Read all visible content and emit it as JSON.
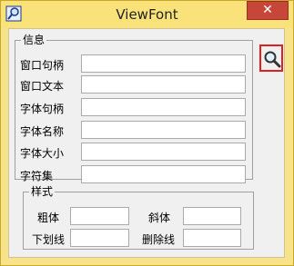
{
  "window": {
    "title": "ViewFont",
    "close_label": "✕"
  },
  "info": {
    "legend": "信息",
    "rows": [
      {
        "label": "窗口句柄",
        "value": ""
      },
      {
        "label": "窗口文本",
        "value": ""
      },
      {
        "label": "字体句柄",
        "value": ""
      },
      {
        "label": "字体名称",
        "value": ""
      },
      {
        "label": "字体大小",
        "value": ""
      },
      {
        "label": "字符集",
        "value": ""
      }
    ]
  },
  "style": {
    "legend": "样式",
    "bold_label": "粗体",
    "italic_label": "斜体",
    "underline_label": "下划线",
    "strikeout_label": "删除线"
  },
  "icons": {
    "app": "magnifier-icon",
    "search": "magnifier-icon"
  },
  "colors": {
    "frame": "#f7e48a",
    "close": "#c7463a",
    "highlight": "#e02020"
  }
}
